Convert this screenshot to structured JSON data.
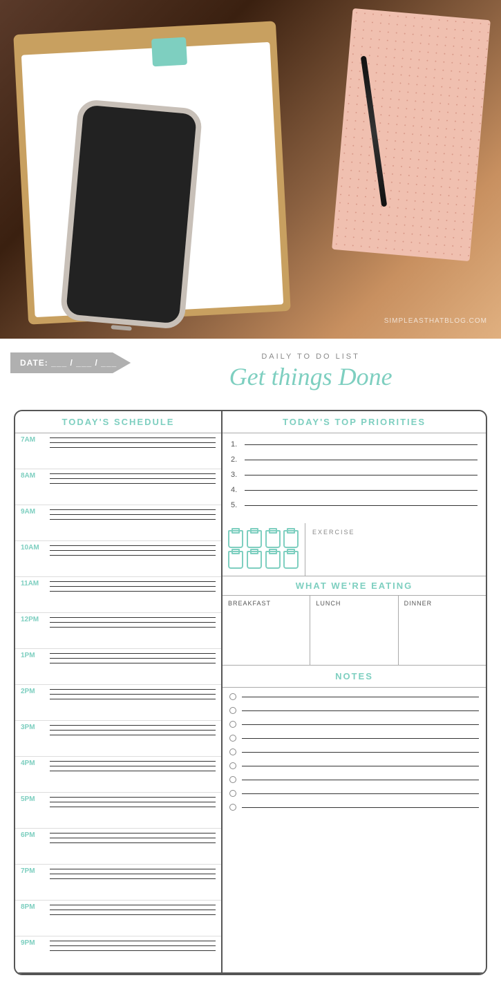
{
  "photo": {
    "watermark": "SIMPLEASTHATBLOG.COM"
  },
  "header": {
    "date_label": "DATE:",
    "date_fields": "___ / ___ / ___",
    "subtitle": "DAILY TO DO LIST",
    "title": "Get things Done"
  },
  "schedule": {
    "header": "TODAY'S SCHEDULE",
    "times": [
      "7AM",
      "8AM",
      "9AM",
      "10AM",
      "11AM",
      "12PM",
      "1PM",
      "2PM",
      "3PM",
      "4PM",
      "5PM",
      "6PM",
      "7PM",
      "8PM",
      "9PM"
    ]
  },
  "priorities": {
    "header": "TODAY'S TOP PRIORITIES",
    "items": [
      "1.",
      "2.",
      "3.",
      "4.",
      "5."
    ]
  },
  "water": {
    "cups": 8
  },
  "exercise": {
    "label": "EXERCISE"
  },
  "eating": {
    "header": "WHAT WE'RE EATING",
    "meals": [
      "BREAKFAST",
      "LUNCH",
      "DINNER"
    ]
  },
  "notes": {
    "header": "NOTES",
    "items": 9
  }
}
